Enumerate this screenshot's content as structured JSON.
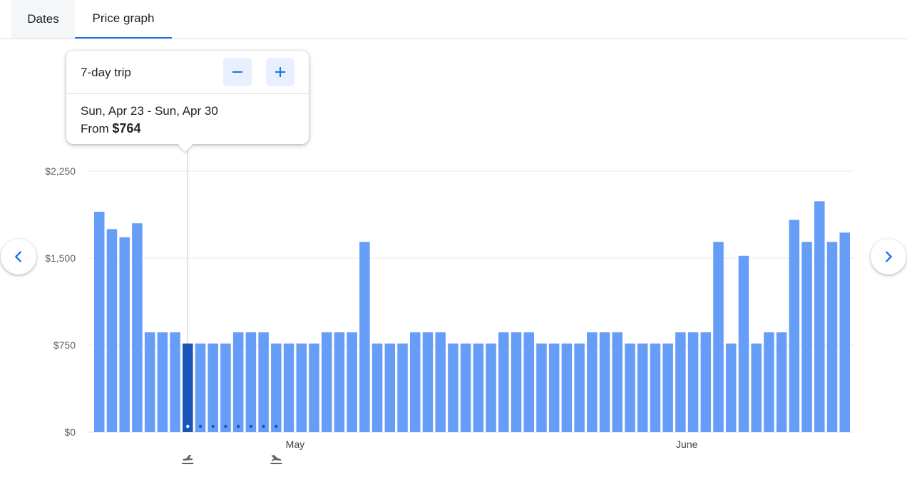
{
  "tabs": {
    "dates": "Dates",
    "price_graph": "Price graph",
    "active": "price_graph"
  },
  "popup": {
    "trip_length": "7-day trip",
    "dates": "Sun, Apr 23 - Sun, Apr 30",
    "from_label": "From",
    "price": "$764",
    "minus_icon": "minus-icon",
    "plus_icon": "plus-icon"
  },
  "navigation": {
    "prev_icon": "chevron-left-icon",
    "next_icon": "chevron-right-icon"
  },
  "colors": {
    "bar": "#669df6",
    "bar_selected": "#1a56b8",
    "accent": "#1a73e8",
    "grid": "#e8eaed"
  },
  "chart_data": {
    "type": "bar",
    "xlabel": "",
    "ylabel": "",
    "ylim": [
      0,
      2250
    ],
    "y_ticks": [
      0,
      750,
      1500,
      2250
    ],
    "y_tick_labels": [
      "$0",
      "$750",
      "$1,500",
      "$2,250"
    ],
    "x_tick_labels": [
      {
        "label": "May",
        "index": 15.5
      },
      {
        "label": "June",
        "index": 46.5
      }
    ],
    "selected_index": 7,
    "trip_end_index": 14,
    "grid": true,
    "values": [
      1900,
      1750,
      1680,
      1800,
      860,
      860,
      860,
      764,
      764,
      764,
      764,
      860,
      860,
      860,
      764,
      764,
      764,
      764,
      860,
      860,
      860,
      1640,
      764,
      764,
      764,
      860,
      860,
      860,
      764,
      764,
      764,
      764,
      860,
      860,
      860,
      764,
      764,
      764,
      764,
      860,
      860,
      860,
      764,
      764,
      764,
      764,
      860,
      860,
      860,
      1640,
      764,
      1520,
      764,
      860,
      860,
      1830,
      1640,
      1990,
      1640,
      1720
    ]
  }
}
